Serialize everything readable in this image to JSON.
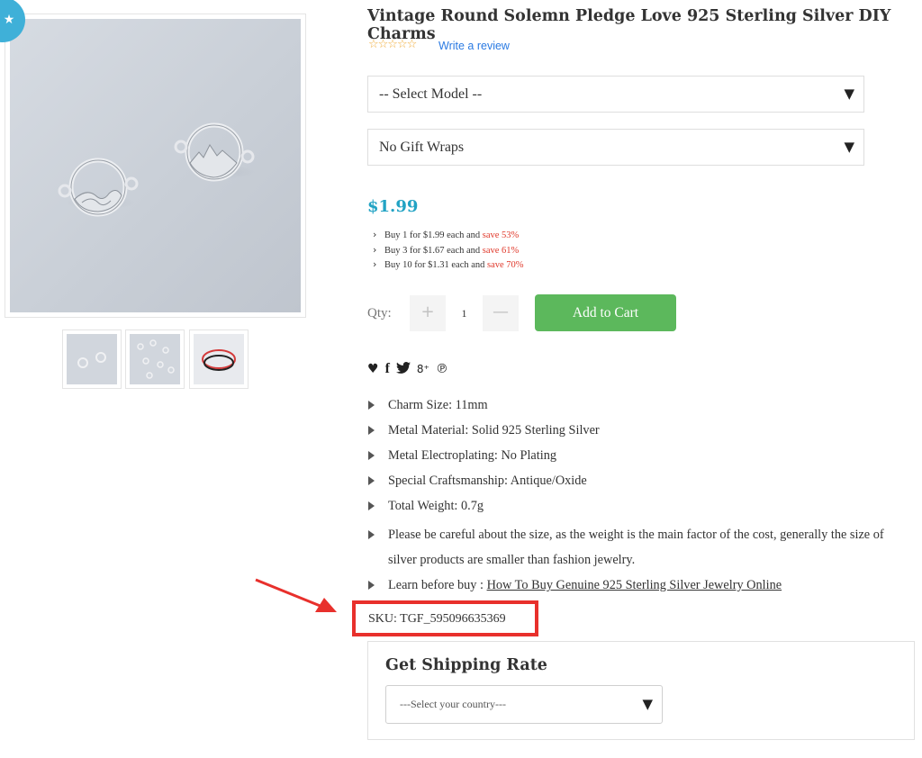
{
  "product": {
    "title": "Vintage Round Solemn Pledge Love 925 Sterling Silver DIY Charms",
    "rating_stars": "☆☆☆☆☆",
    "review_link": "Write a review",
    "badge_icon": "star-icon"
  },
  "options": {
    "model_select": "-- Select Model --",
    "gift_select": "No Gift Wraps"
  },
  "pricing": {
    "price": "$1.99",
    "tiers": [
      {
        "text": "Buy 1 for $1.99 each and ",
        "save": "save 53%"
      },
      {
        "text": "Buy 3 for $1.67 each and ",
        "save": "save 61%"
      },
      {
        "text": "Buy 10 for $1.31 each and ",
        "save": "save 70%"
      }
    ]
  },
  "cart": {
    "qty_label": "Qty:",
    "qty_value": "1",
    "plus": "+",
    "minus": "—",
    "add_to_cart": "Add to Cart"
  },
  "social": {
    "heart": "♥",
    "facebook": "f",
    "twitter": "🐦",
    "gplus": "8⁺",
    "pinterest": "℗"
  },
  "specs": {
    "charm_size": "Charm Size: 11mm",
    "metal_material": "Metal Material: Solid 925 Sterling Silver",
    "electroplating": "Metal Electroplating: No Plating",
    "craftsmanship": "Special Craftsmanship: Antique/Oxide",
    "total_weight": "Total Weight: 0.7g",
    "note": "Please be careful about the size, as the weight is the main factor of the cost, generally the size of silver products are smaller than fashion jewelry.",
    "learn_prefix": "Learn before buy : ",
    "learn_link": "How To Buy Genuine 925 Sterling Silver Jewelry Online"
  },
  "sku": "SKU: TGF_595096635369",
  "shipping": {
    "heading": "Get Shipping Rate",
    "country_placeholder": "---Select your country---"
  },
  "colors": {
    "price": "#22a3c4",
    "save": "#e0392b",
    "add_to_cart": "#5cb85c",
    "highlight": "#e8302c",
    "badge": "#3fb0d8"
  }
}
